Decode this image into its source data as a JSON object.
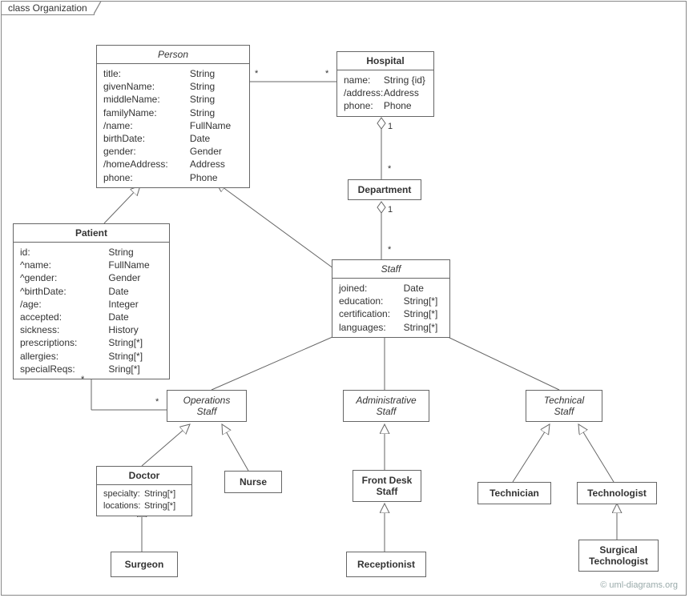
{
  "frame_title": "class Organization",
  "watermark": "© uml-diagrams.org",
  "classes": {
    "person": {
      "title": "Person",
      "attrs": [
        [
          "title:",
          "String"
        ],
        [
          "givenName:",
          "String"
        ],
        [
          "middleName:",
          "String"
        ],
        [
          "familyName:",
          "String"
        ],
        [
          "/name:",
          "FullName"
        ],
        [
          "birthDate:",
          "Date"
        ],
        [
          "gender:",
          "Gender"
        ],
        [
          "/homeAddress:",
          "Address"
        ],
        [
          "phone:",
          "Phone"
        ]
      ]
    },
    "hospital": {
      "title": "Hospital",
      "attrs": [
        [
          "name:",
          "String {id}"
        ],
        [
          "/address:",
          "Address"
        ],
        [
          "phone:",
          "Phone"
        ]
      ]
    },
    "department": {
      "title": "Department"
    },
    "patient": {
      "title": "Patient",
      "attrs": [
        [
          "id:",
          "String"
        ],
        [
          "^name:",
          "FullName"
        ],
        [
          "^gender:",
          "Gender"
        ],
        [
          "^birthDate:",
          "Date"
        ],
        [
          "/age:",
          "Integer"
        ],
        [
          "accepted:",
          "Date"
        ],
        [
          "sickness:",
          "History"
        ],
        [
          "prescriptions:",
          "String[*]"
        ],
        [
          "allergies:",
          "String[*]"
        ],
        [
          "specialReqs:",
          "Sring[*]"
        ]
      ]
    },
    "staff": {
      "title": "Staff",
      "attrs": [
        [
          "joined:",
          "Date"
        ],
        [
          "education:",
          "String[*]"
        ],
        [
          "certification:",
          "String[*]"
        ],
        [
          "languages:",
          "String[*]"
        ]
      ]
    },
    "operations_staff": {
      "title_line1": "Operations",
      "title_line2": "Staff"
    },
    "administrative_staff": {
      "title_line1": "Administrative",
      "title_line2": "Staff"
    },
    "technical_staff": {
      "title_line1": "Technical",
      "title_line2": "Staff"
    },
    "doctor": {
      "title": "Doctor",
      "attrs": [
        [
          "specialty:",
          "String[*]"
        ],
        [
          "locations:",
          "String[*]"
        ]
      ]
    },
    "nurse": {
      "title": "Nurse"
    },
    "front_desk": {
      "title_line1": "Front Desk",
      "title_line2": "Staff"
    },
    "technician": {
      "title": "Technician"
    },
    "technologist": {
      "title": "Technologist"
    },
    "surgeon": {
      "title": "Surgeon"
    },
    "receptionist": {
      "title": "Receptionist"
    },
    "surgical_technologist": {
      "title_line1": "Surgical",
      "title_line2": "Technologist"
    }
  },
  "mult": {
    "m1": "*",
    "m2": "*",
    "m3": "1",
    "m4": "*",
    "m5": "1",
    "m6": "*",
    "m7": "*",
    "m8": "*"
  }
}
